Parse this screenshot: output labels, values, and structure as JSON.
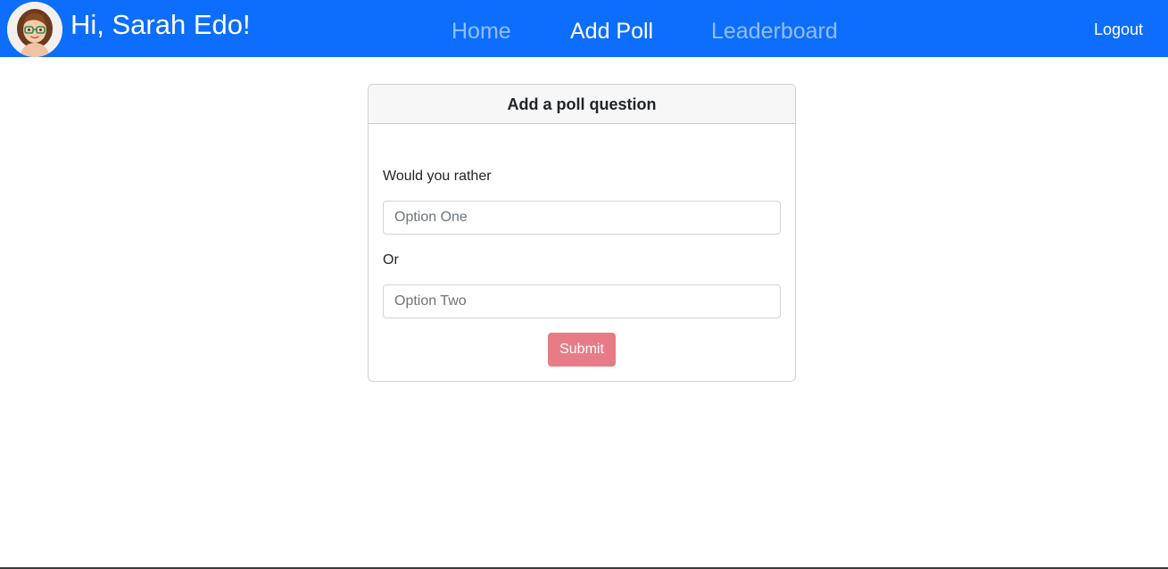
{
  "navbar": {
    "avatar_icon": "female-avatar-icon",
    "greeting": "Hi, Sarah Edo!",
    "links": [
      {
        "label": "Home",
        "active": false
      },
      {
        "label": "Add Poll",
        "active": true
      },
      {
        "label": "Leaderboard",
        "active": false
      }
    ],
    "logout_label": "Logout",
    "background_color": "#0d6efd"
  },
  "card": {
    "title": "Add a poll question",
    "question_label": "Would you rather",
    "option_one": {
      "value": "",
      "placeholder": "Option One"
    },
    "or_label": "Or",
    "option_two": {
      "value": "",
      "placeholder": "Option Two"
    },
    "submit_label": "Submit",
    "submit_color": "#e77c87"
  }
}
